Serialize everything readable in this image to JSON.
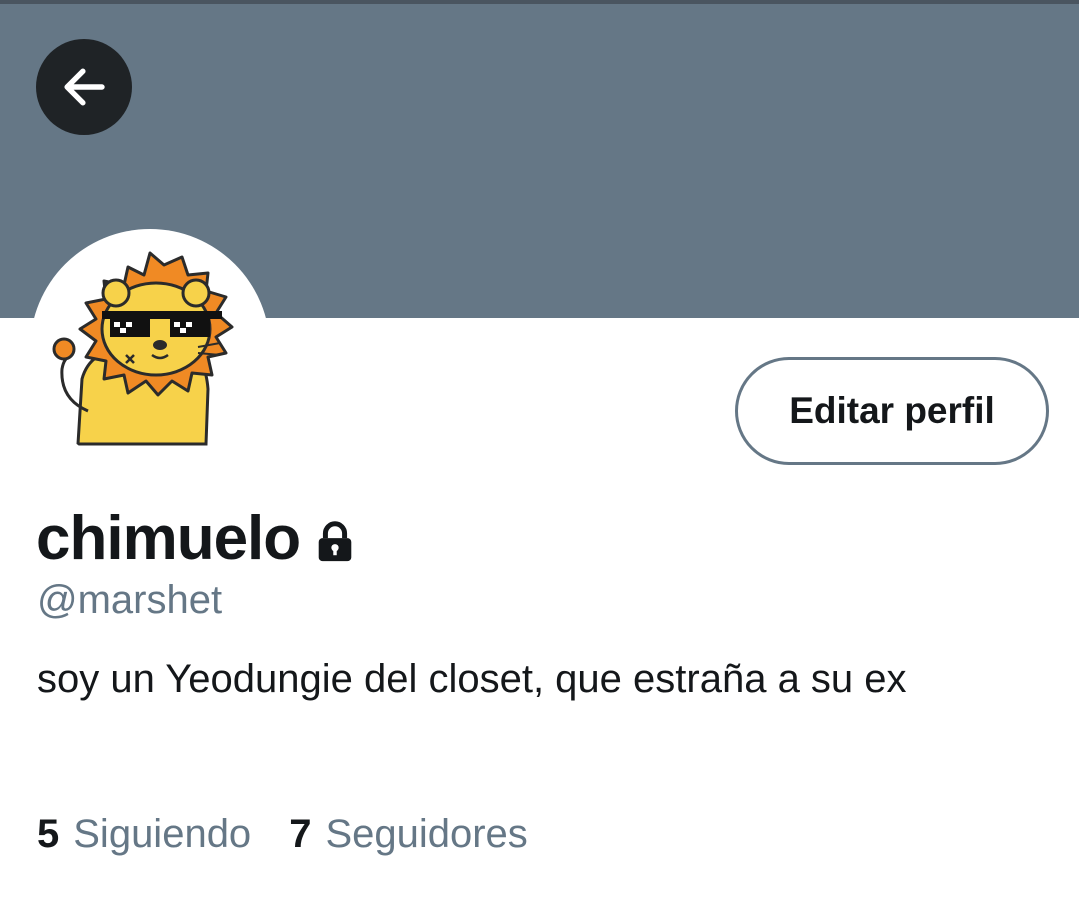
{
  "profile": {
    "display_name": "chimuelo",
    "handle": "@marshet",
    "bio": "soy un Yeodungie del closet, que estraña a su ex",
    "protected_icon": "lock-icon",
    "avatar_icon": "lion-cartoon-avatar"
  },
  "header": {
    "back_icon": "arrow-left-icon",
    "banner_color": "#657786"
  },
  "actions": {
    "edit_label": "Editar perfil"
  },
  "stats": {
    "following_count": "5",
    "following_label": "Siguiendo",
    "followers_count": "7",
    "followers_label": "Seguidores"
  },
  "colors": {
    "text_primary": "#14171a",
    "text_secondary": "#657786",
    "back_button_bg": "#1f2326"
  }
}
